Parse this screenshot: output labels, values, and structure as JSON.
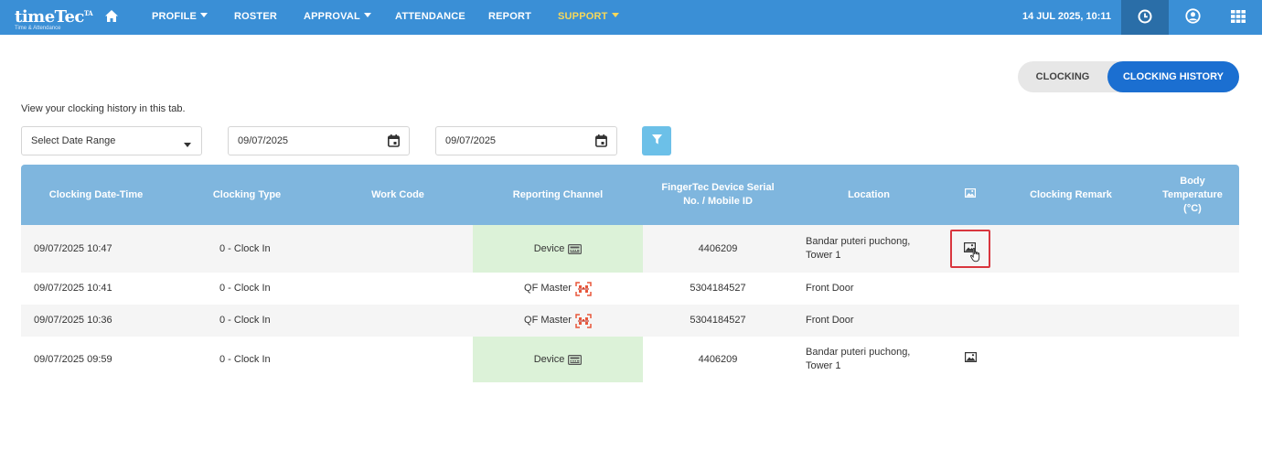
{
  "app": {
    "logo_main": "timeTec",
    "logo_sup": "TA",
    "logo_sub": "Time & Attendance"
  },
  "nav": {
    "items": [
      {
        "label": "PROFILE",
        "dropdown": true
      },
      {
        "label": "ROSTER",
        "dropdown": false
      },
      {
        "label": "APPROVAL",
        "dropdown": true
      },
      {
        "label": "ATTENDANCE",
        "dropdown": false
      },
      {
        "label": "REPORT",
        "dropdown": false
      },
      {
        "label": "SUPPORT",
        "dropdown": true,
        "active": true
      }
    ],
    "datetime": "14 JUL 2025, 10:11"
  },
  "toggle": {
    "clocking": "CLOCKING",
    "history": "CLOCKING HISTORY"
  },
  "description": "View your clocking history in this tab.",
  "filters": {
    "range_select": "Select Date Range",
    "from_date": "09/07/2025",
    "to_date": "09/07/2025"
  },
  "table": {
    "headers": {
      "datetime": "Clocking Date-Time",
      "type": "Clocking Type",
      "workcode": "Work Code",
      "channel": "Reporting Channel",
      "serial_1": "FingerTec Device Serial",
      "serial_2": "No. / Mobile ID",
      "location": "Location",
      "remark": "Clocking Remark",
      "temp_1": "Body",
      "temp_2": "Temperature",
      "temp_3": "(°C)"
    },
    "rows": [
      {
        "datetime": "09/07/2025 10:47",
        "type": "0 - Clock In",
        "channel": "Device",
        "serial": "4406209",
        "location_1": "Bandar puteri puchong,",
        "location_2": "Tower 1"
      },
      {
        "datetime": "09/07/2025 10:41",
        "type": "0 - Clock In",
        "channel": "QF Master",
        "serial": "5304184527",
        "location_1": "Front Door",
        "location_2": ""
      },
      {
        "datetime": "09/07/2025 10:36",
        "type": "0 - Clock In",
        "channel": "QF Master",
        "serial": "5304184527",
        "location_1": "Front Door",
        "location_2": ""
      },
      {
        "datetime": "09/07/2025 09:59",
        "type": "0 - Clock In",
        "channel": "Device",
        "serial": "4406209",
        "location_1": "Bandar puteri puchong,",
        "location_2": "Tower 1"
      }
    ]
  },
  "colors": {
    "topbar": "#3a8fd6",
    "active_nav": "#f6d85b",
    "table_header": "#7fb6de",
    "device_channel_bg": "#dcf2d8",
    "toggle_active": "#1b6fd1"
  }
}
